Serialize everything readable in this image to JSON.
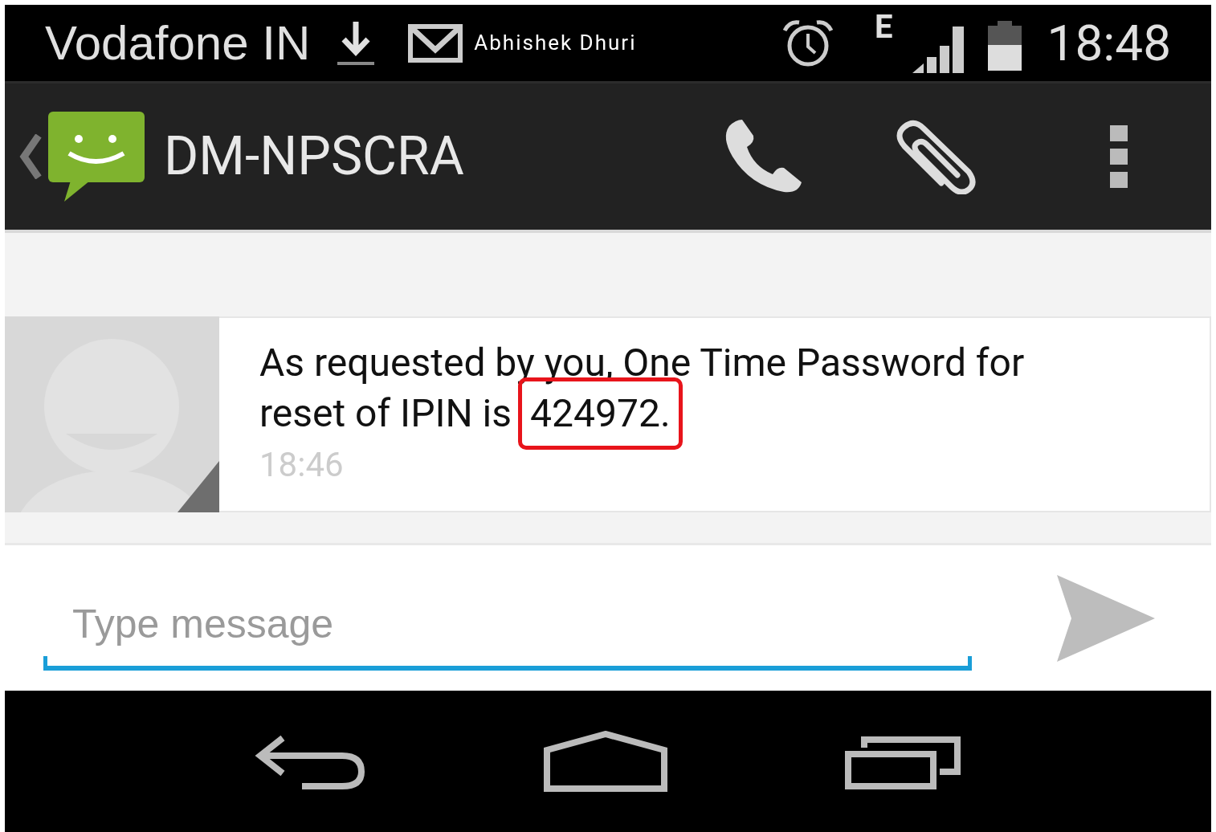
{
  "status_bar": {
    "carrier": "Vodafone IN",
    "notification": "Abhishek Dhuri",
    "network_type": "E",
    "time": "18:48"
  },
  "action_bar": {
    "title": "DM-NPSCRA"
  },
  "message": {
    "line_1": "As requested by you, One Time Password for",
    "line_2": "reset of IPIN is",
    "code": "424972.",
    "code_highlighted": true,
    "time": "18:46"
  },
  "compose": {
    "placeholder": "Type message"
  }
}
